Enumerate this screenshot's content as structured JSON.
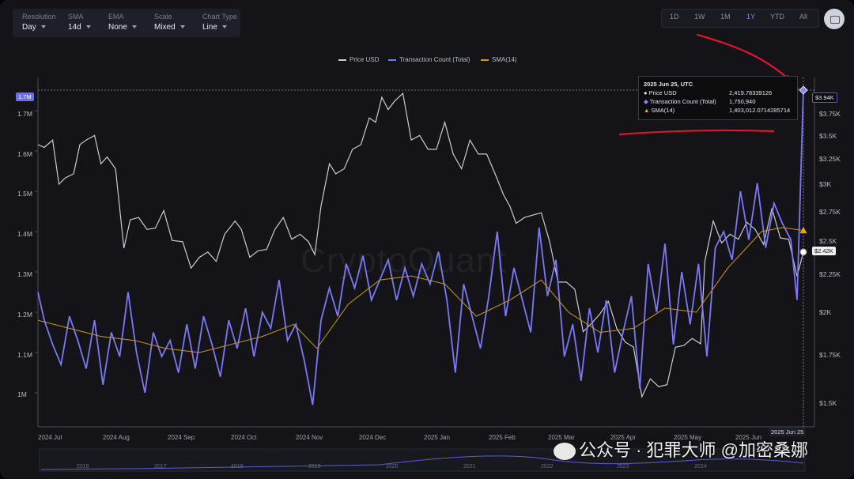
{
  "controls": [
    {
      "label": "Resolution",
      "value": "Day"
    },
    {
      "label": "SMA",
      "value": "14d"
    },
    {
      "label": "EMA",
      "value": "None"
    },
    {
      "label": "Scale",
      "value": "Mixed"
    },
    {
      "label": "Chart Type",
      "value": "Line"
    }
  ],
  "timeframes": [
    "1D",
    "1W",
    "1M",
    "1Y",
    "YTD",
    "All"
  ],
  "active_timeframe": "1Y",
  "watermark": "CryptoQuant",
  "overlay_text": "公众号 · 犯罪大师 @加密桑娜",
  "tooltip": {
    "date": "2025 Jun 25, UTC",
    "rows": [
      {
        "label": "Price USD",
        "value": "2,419.78339126"
      },
      {
        "label": "Transaction Count (Total)",
        "value": "1,750,940"
      },
      {
        "label": "SMA(14)",
        "value": "1,403,012.0714285714"
      }
    ]
  },
  "crosshair_label_left": "1.7M",
  "crosshair_label_right": "$3.94K",
  "price_badge": "$2.42K",
  "date_badge": "2025 Jun 25",
  "navigator_years": [
    "2016",
    "2017",
    "2018",
    "2019",
    "2020",
    "2021",
    "2022",
    "2023",
    "2024"
  ],
  "colors": {
    "price": "#c9cad3",
    "tx": "#7a78f5",
    "sma": "#c99a1a",
    "annotation": "#e0162c",
    "bg": "#141418"
  },
  "chart_data": {
    "type": "line",
    "legend_position": "top-center",
    "x_tick_labels": [
      "2024 Jul",
      "2024 Aug",
      "2024 Sep",
      "2024 Oct",
      "2024 Nov",
      "2024 Dec",
      "2025 Jan",
      "2025 Feb",
      "2025 Mar",
      "2025 Apr",
      "2025 May",
      "2025 Jun"
    ],
    "y_left": {
      "ticks": [
        "1M",
        "1.1M",
        "1.2M",
        "1.3M",
        "1.4M",
        "1.5M",
        "1.6M",
        "1.7M"
      ],
      "range": [
        930000,
        1720000
      ]
    },
    "y_right": {
      "scale": "log",
      "ticks": [
        "$1.5K",
        "$1.75K",
        "$2K",
        "$2.25K",
        "$2.5K",
        "$2.75K",
        "$3K",
        "$3.25K",
        "$3.5K",
        "$3.75K"
      ],
      "range": [
        1450,
        4050
      ]
    },
    "series": [
      {
        "name": "Price USD",
        "axis": "right",
        "points": [
          [
            "2024-06-25",
            3400
          ],
          [
            "2024-06-28",
            3370
          ],
          [
            "2024-07-02",
            3450
          ],
          [
            "2024-07-05",
            3000
          ],
          [
            "2024-07-08",
            3060
          ],
          [
            "2024-07-12",
            3100
          ],
          [
            "2024-07-15",
            3400
          ],
          [
            "2024-07-18",
            3450
          ],
          [
            "2024-07-22",
            3500
          ],
          [
            "2024-07-25",
            3200
          ],
          [
            "2024-07-28",
            3270
          ],
          [
            "2024-08-01",
            3150
          ],
          [
            "2024-08-05",
            2450
          ],
          [
            "2024-08-08",
            2680
          ],
          [
            "2024-08-12",
            2700
          ],
          [
            "2024-08-16",
            2600
          ],
          [
            "2024-08-20",
            2610
          ],
          [
            "2024-08-24",
            2760
          ],
          [
            "2024-08-28",
            2510
          ],
          [
            "2024-09-02",
            2500
          ],
          [
            "2024-09-06",
            2300
          ],
          [
            "2024-09-10",
            2380
          ],
          [
            "2024-09-14",
            2420
          ],
          [
            "2024-09-18",
            2350
          ],
          [
            "2024-09-22",
            2560
          ],
          [
            "2024-09-27",
            2670
          ],
          [
            "2024-09-30",
            2600
          ],
          [
            "2024-10-04",
            2380
          ],
          [
            "2024-10-08",
            2430
          ],
          [
            "2024-10-12",
            2440
          ],
          [
            "2024-10-16",
            2600
          ],
          [
            "2024-10-20",
            2700
          ],
          [
            "2024-10-24",
            2520
          ],
          [
            "2024-10-28",
            2560
          ],
          [
            "2024-11-01",
            2500
          ],
          [
            "2024-11-04",
            2400
          ],
          [
            "2024-11-07",
            2800
          ],
          [
            "2024-11-11",
            3200
          ],
          [
            "2024-11-14",
            3100
          ],
          [
            "2024-11-18",
            3150
          ],
          [
            "2024-11-22",
            3350
          ],
          [
            "2024-11-26",
            3400
          ],
          [
            "2024-11-30",
            3700
          ],
          [
            "2024-12-03",
            3650
          ],
          [
            "2024-12-06",
            3950
          ],
          [
            "2024-12-09",
            3800
          ],
          [
            "2024-12-12",
            3900
          ],
          [
            "2024-12-16",
            4000
          ],
          [
            "2024-12-20",
            3450
          ],
          [
            "2024-12-24",
            3500
          ],
          [
            "2024-12-28",
            3350
          ],
          [
            "2025-01-01",
            3350
          ],
          [
            "2025-01-05",
            3650
          ],
          [
            "2025-01-09",
            3300
          ],
          [
            "2025-01-13",
            3150
          ],
          [
            "2025-01-17",
            3450
          ],
          [
            "2025-01-21",
            3300
          ],
          [
            "2025-01-25",
            3300
          ],
          [
            "2025-01-29",
            3100
          ],
          [
            "2025-02-02",
            2900
          ],
          [
            "2025-02-05",
            2800
          ],
          [
            "2025-02-08",
            2650
          ],
          [
            "2025-02-12",
            2700
          ],
          [
            "2025-02-16",
            2720
          ],
          [
            "2025-02-20",
            2740
          ],
          [
            "2025-02-24",
            2500
          ],
          [
            "2025-02-28",
            2200
          ],
          [
            "2025-03-04",
            2200
          ],
          [
            "2025-03-08",
            2150
          ],
          [
            "2025-03-12",
            1880
          ],
          [
            "2025-03-16",
            1930
          ],
          [
            "2025-03-20",
            1990
          ],
          [
            "2025-03-24",
            2070
          ],
          [
            "2025-03-28",
            1900
          ],
          [
            "2025-04-01",
            1820
          ],
          [
            "2025-04-05",
            1790
          ],
          [
            "2025-04-09",
            1530
          ],
          [
            "2025-04-13",
            1620
          ],
          [
            "2025-04-17",
            1580
          ],
          [
            "2025-04-21",
            1590
          ],
          [
            "2025-04-25",
            1790
          ],
          [
            "2025-04-29",
            1800
          ],
          [
            "2025-05-03",
            1840
          ],
          [
            "2025-05-07",
            1810
          ],
          [
            "2025-05-09",
            2350
          ],
          [
            "2025-05-13",
            2670
          ],
          [
            "2025-05-17",
            2490
          ],
          [
            "2025-05-21",
            2560
          ],
          [
            "2025-05-25",
            2520
          ],
          [
            "2025-05-29",
            2660
          ],
          [
            "2025-06-02",
            2600
          ],
          [
            "2025-06-06",
            2480
          ],
          [
            "2025-06-10",
            2780
          ],
          [
            "2025-06-14",
            2530
          ],
          [
            "2025-06-18",
            2520
          ],
          [
            "2025-06-22",
            2240
          ],
          [
            "2025-06-25",
            2420
          ]
        ]
      },
      {
        "name": "Transaction Count (Total)",
        "axis": "left",
        "points": [
          [
            "2024-06-25",
            1250000
          ],
          [
            "2024-06-28",
            1180000
          ],
          [
            "2024-07-02",
            1120000
          ],
          [
            "2024-07-06",
            1070000
          ],
          [
            "2024-07-10",
            1190000
          ],
          [
            "2024-07-14",
            1130000
          ],
          [
            "2024-07-18",
            1060000
          ],
          [
            "2024-07-22",
            1180000
          ],
          [
            "2024-07-26",
            1020000
          ],
          [
            "2024-07-30",
            1150000
          ],
          [
            "2024-08-03",
            1090000
          ],
          [
            "2024-08-07",
            1250000
          ],
          [
            "2024-08-11",
            1100000
          ],
          [
            "2024-08-15",
            1000000
          ],
          [
            "2024-08-19",
            1150000
          ],
          [
            "2024-08-23",
            1090000
          ],
          [
            "2024-08-27",
            1130000
          ],
          [
            "2024-08-31",
            1050000
          ],
          [
            "2024-09-04",
            1170000
          ],
          [
            "2024-09-08",
            1060000
          ],
          [
            "2024-09-12",
            1190000
          ],
          [
            "2024-09-16",
            1120000
          ],
          [
            "2024-09-20",
            1040000
          ],
          [
            "2024-09-24",
            1180000
          ],
          [
            "2024-09-28",
            1110000
          ],
          [
            "2024-10-02",
            1210000
          ],
          [
            "2024-10-06",
            1090000
          ],
          [
            "2024-10-10",
            1200000
          ],
          [
            "2024-10-14",
            1160000
          ],
          [
            "2024-10-18",
            1280000
          ],
          [
            "2024-10-22",
            1130000
          ],
          [
            "2024-10-26",
            1170000
          ],
          [
            "2024-10-30",
            1080000
          ],
          [
            "2024-11-03",
            970000
          ],
          [
            "2024-11-07",
            1180000
          ],
          [
            "2024-11-11",
            1260000
          ],
          [
            "2024-11-15",
            1190000
          ],
          [
            "2024-11-19",
            1320000
          ],
          [
            "2024-11-23",
            1260000
          ],
          [
            "2024-11-27",
            1340000
          ],
          [
            "2024-12-01",
            1230000
          ],
          [
            "2024-12-05",
            1280000
          ],
          [
            "2024-12-09",
            1330000
          ],
          [
            "2024-12-13",
            1230000
          ],
          [
            "2024-12-17",
            1310000
          ],
          [
            "2024-12-21",
            1240000
          ],
          [
            "2024-12-25",
            1320000
          ],
          [
            "2024-12-29",
            1270000
          ],
          [
            "2025-01-02",
            1350000
          ],
          [
            "2025-01-06",
            1230000
          ],
          [
            "2025-01-10",
            1050000
          ],
          [
            "2025-01-14",
            1270000
          ],
          [
            "2025-01-18",
            1190000
          ],
          [
            "2025-01-22",
            1110000
          ],
          [
            "2025-01-26",
            1240000
          ],
          [
            "2025-01-30",
            1400000
          ],
          [
            "2025-02-03",
            1190000
          ],
          [
            "2025-02-07",
            1310000
          ],
          [
            "2025-02-11",
            1230000
          ],
          [
            "2025-02-15",
            1150000
          ],
          [
            "2025-02-19",
            1410000
          ],
          [
            "2025-02-23",
            1240000
          ],
          [
            "2025-02-27",
            1330000
          ],
          [
            "2025-03-03",
            1090000
          ],
          [
            "2025-03-07",
            1170000
          ],
          [
            "2025-03-11",
            1030000
          ],
          [
            "2025-03-15",
            1210000
          ],
          [
            "2025-03-19",
            1100000
          ],
          [
            "2025-03-23",
            1230000
          ],
          [
            "2025-03-27",
            1050000
          ],
          [
            "2025-03-31",
            1150000
          ],
          [
            "2025-04-04",
            1240000
          ],
          [
            "2025-04-08",
            1010000
          ],
          [
            "2025-04-12",
            1320000
          ],
          [
            "2025-04-16",
            1200000
          ],
          [
            "2025-04-20",
            1370000
          ],
          [
            "2025-04-24",
            1120000
          ],
          [
            "2025-04-28",
            1300000
          ],
          [
            "2025-05-02",
            1170000
          ],
          [
            "2025-05-06",
            1320000
          ],
          [
            "2025-05-10",
            1090000
          ],
          [
            "2025-05-14",
            1360000
          ],
          [
            "2025-05-18",
            1400000
          ],
          [
            "2025-05-22",
            1330000
          ],
          [
            "2025-05-26",
            1500000
          ],
          [
            "2025-05-30",
            1380000
          ],
          [
            "2025-06-03",
            1520000
          ],
          [
            "2025-06-07",
            1360000
          ],
          [
            "2025-06-11",
            1470000
          ],
          [
            "2025-06-15",
            1420000
          ],
          [
            "2025-06-19",
            1380000
          ],
          [
            "2025-06-22",
            1230000
          ],
          [
            "2025-06-25",
            1750940
          ]
        ]
      },
      {
        "name": "SMA(14)",
        "axis": "left",
        "points": [
          [
            "2024-06-25",
            1180000
          ],
          [
            "2024-07-10",
            1160000
          ],
          [
            "2024-07-25",
            1140000
          ],
          [
            "2024-08-10",
            1130000
          ],
          [
            "2024-08-25",
            1110000
          ],
          [
            "2024-09-10",
            1100000
          ],
          [
            "2024-09-25",
            1120000
          ],
          [
            "2024-10-10",
            1140000
          ],
          [
            "2024-10-25",
            1170000
          ],
          [
            "2024-11-05",
            1110000
          ],
          [
            "2024-11-20",
            1220000
          ],
          [
            "2024-12-05",
            1280000
          ],
          [
            "2024-12-20",
            1290000
          ],
          [
            "2025-01-05",
            1270000
          ],
          [
            "2025-01-20",
            1190000
          ],
          [
            "2025-02-05",
            1230000
          ],
          [
            "2025-02-20",
            1280000
          ],
          [
            "2025-03-05",
            1200000
          ],
          [
            "2025-03-20",
            1150000
          ],
          [
            "2025-04-05",
            1160000
          ],
          [
            "2025-04-20",
            1210000
          ],
          [
            "2025-05-05",
            1200000
          ],
          [
            "2025-05-20",
            1310000
          ],
          [
            "2025-06-05",
            1400000
          ],
          [
            "2025-06-15",
            1410000
          ],
          [
            "2025-06-25",
            1403012
          ]
        ]
      }
    ]
  }
}
